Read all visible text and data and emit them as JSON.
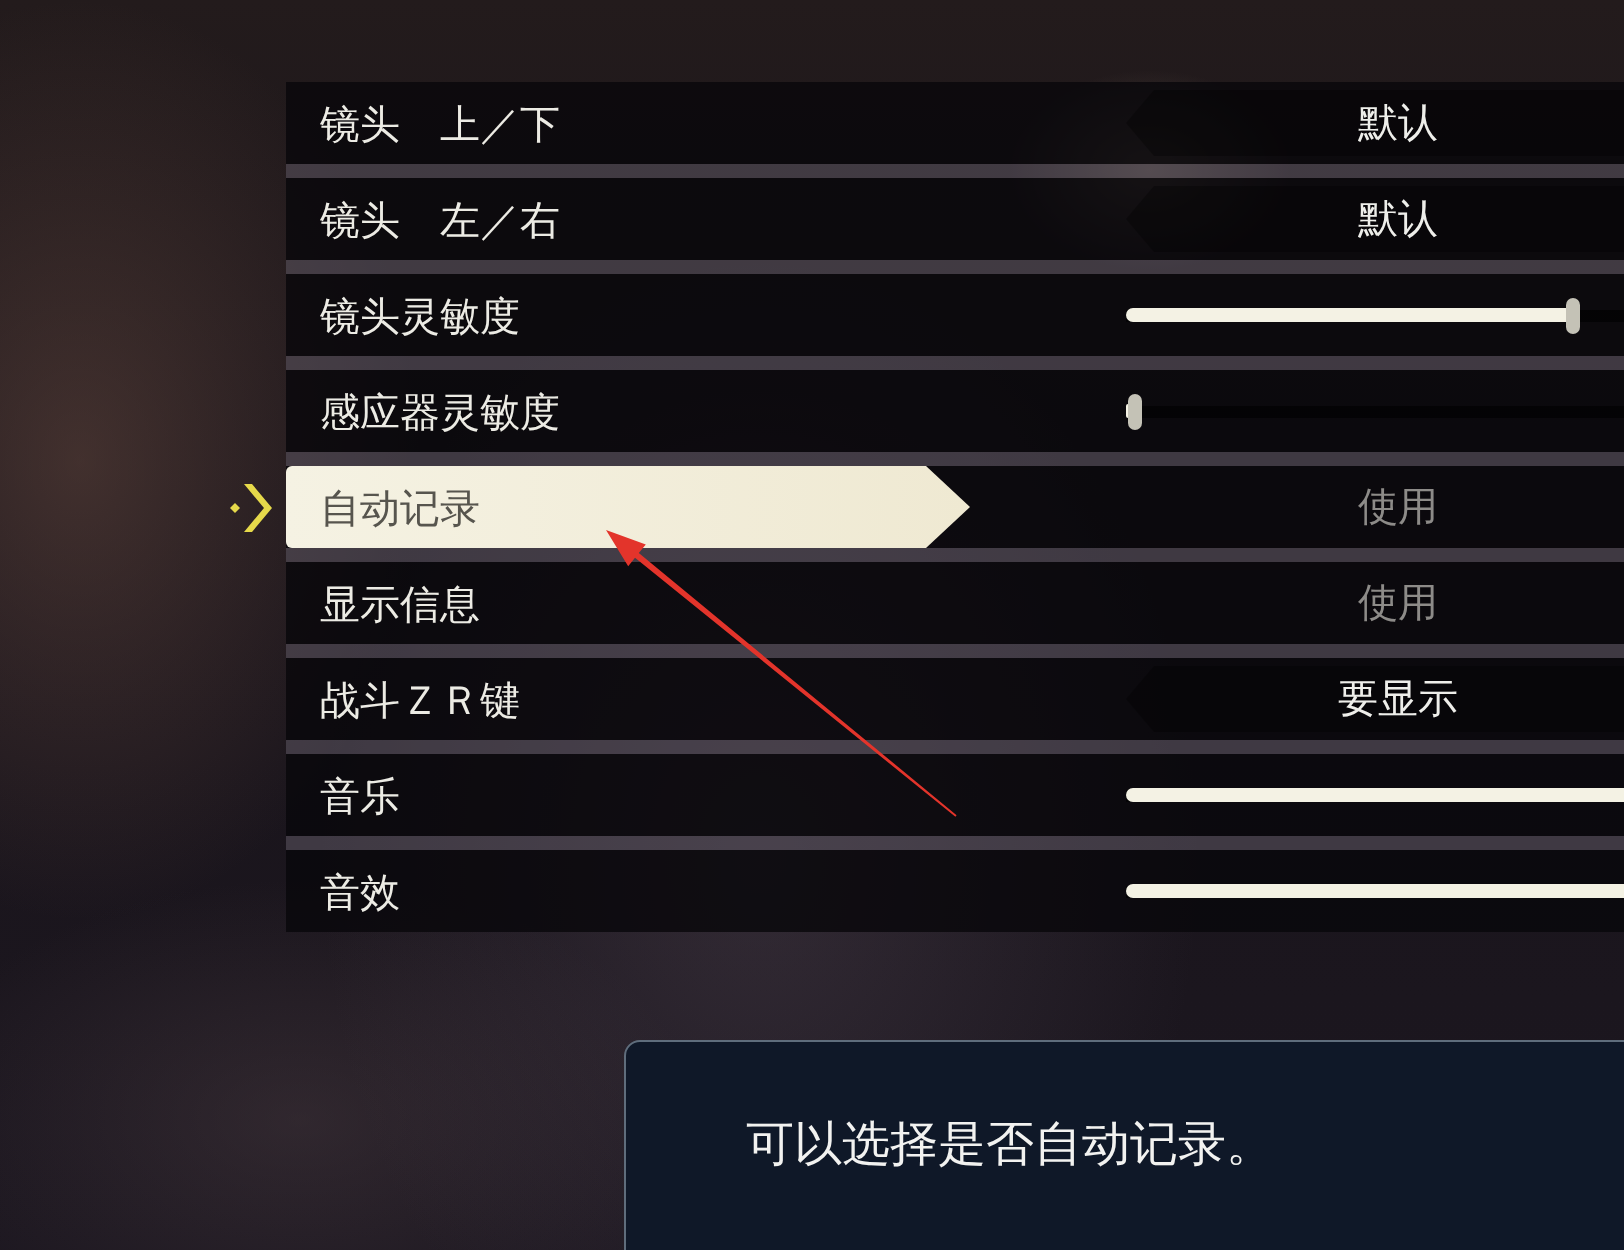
{
  "settings": [
    {
      "label": "镜头　上／下",
      "kind": "option",
      "value": "默认",
      "disabled": false,
      "selected": false
    },
    {
      "label": "镜头　左／右",
      "kind": "option",
      "value": "默认",
      "disabled": false,
      "selected": false
    },
    {
      "label": "镜头灵敏度",
      "kind": "slider",
      "level": 0.83,
      "disabled": false,
      "selected": false
    },
    {
      "label": "感应器灵敏度",
      "kind": "slider",
      "level": 0,
      "disabled": false,
      "selected": false
    },
    {
      "label": "自动记录",
      "kind": "option",
      "value": "使用",
      "disabled": true,
      "selected": true
    },
    {
      "label": "显示信息",
      "kind": "option",
      "value": "使用",
      "disabled": true,
      "selected": false
    },
    {
      "label": "战斗ＺＲ键",
      "kind": "option",
      "value": "要显示",
      "disabled": false,
      "selected": false
    },
    {
      "label": "音乐",
      "kind": "slider",
      "level": 1,
      "disabled": false,
      "selected": false
    },
    {
      "label": "音效",
      "kind": "slider",
      "level": 1,
      "disabled": false,
      "selected": false
    }
  ],
  "description": "可以选择是否自动记录。"
}
